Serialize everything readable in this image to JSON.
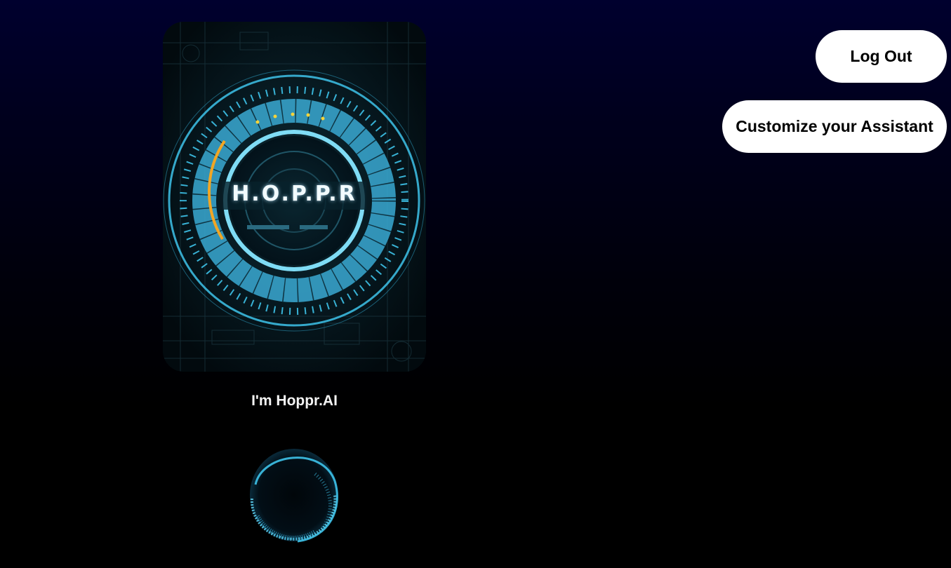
{
  "hero": {
    "logo_text": "H.O.P.P.R",
    "image_icon": "hud-circle-image"
  },
  "assistant": {
    "intro": "I'm Hoppr.AI",
    "orb_icon": "voice-orb-icon"
  },
  "buttons": {
    "logout_label": "Log Out",
    "customize_label": "Customize your Assistant"
  },
  "colors": {
    "accent": "#3ec3ea",
    "accent_light": "#7fdcf5",
    "warning": "#f2a623",
    "background_top": "#00002e",
    "background_bottom": "#000000",
    "button_bg": "#ffffff"
  }
}
